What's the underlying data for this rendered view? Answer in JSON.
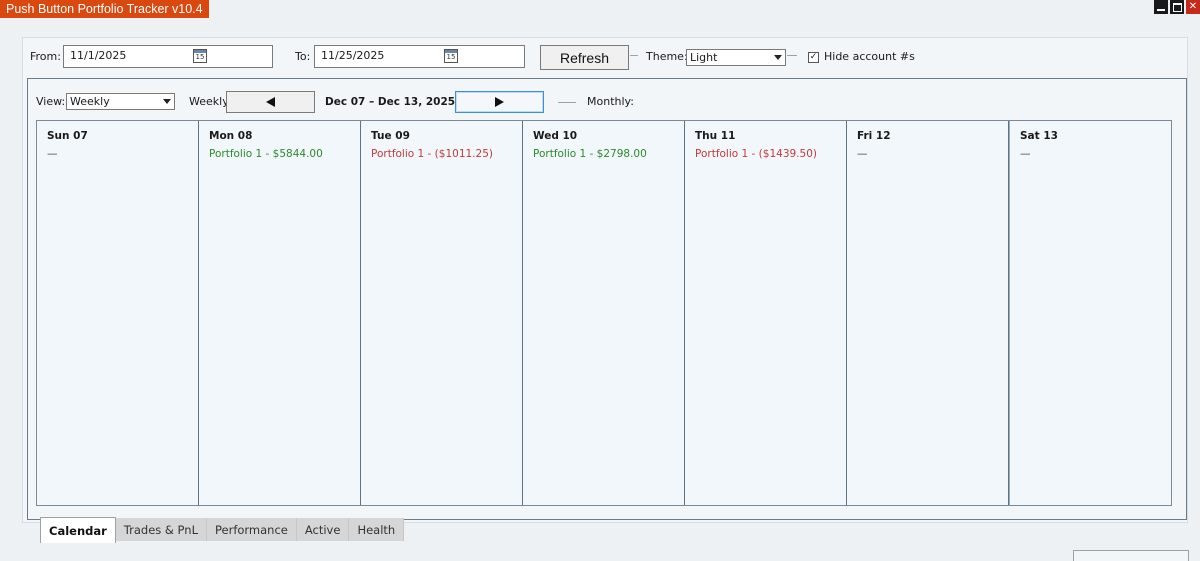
{
  "window": {
    "title": "Push Button Portfolio Tracker v10.4"
  },
  "toolbar": {
    "from_label": "From:",
    "from_value": "11/1/2025",
    "to_label": "To:",
    "to_value": "11/25/2025",
    "calendar_icon_day": "15",
    "refresh_label": "Refresh",
    "theme_label": "Theme:",
    "theme_value": "Light",
    "hide_accounts_label": "Hide account #s",
    "hide_accounts_checked": "✓"
  },
  "calendar": {
    "view_label": "View:",
    "view_value": "Weekly",
    "weekly_label": "Weekly:",
    "range_label": "Dec 07 – Dec 13, 2025",
    "monthly_label": "Monthly:",
    "days": [
      {
        "title": "Sun 07",
        "entry": "—",
        "status": "none"
      },
      {
        "title": "Mon 08",
        "entry": "Portfolio 1 - $5844.00",
        "status": "positive"
      },
      {
        "title": "Tue 09",
        "entry": "Portfolio 1 - ($1011.25)",
        "status": "negative"
      },
      {
        "title": "Wed 10",
        "entry": "Portfolio 1 - $2798.00",
        "status": "positive"
      },
      {
        "title": "Thu 11",
        "entry": "Portfolio 1 - ($1439.50)",
        "status": "negative"
      },
      {
        "title": "Fri 12",
        "entry": "—",
        "status": "none"
      },
      {
        "title": "Sat 13",
        "entry": "—",
        "status": "none"
      }
    ]
  },
  "tabs": [
    {
      "label": "Calendar",
      "active": true
    },
    {
      "label": "Trades & PnL",
      "active": false
    },
    {
      "label": "Performance",
      "active": false
    },
    {
      "label": "Active",
      "active": false
    },
    {
      "label": "Health",
      "active": false
    }
  ],
  "colors": {
    "title_bg": "#d9480f",
    "positive": "#2a8a2a",
    "negative": "#c23a3a",
    "focus": "#3c8ed8"
  }
}
